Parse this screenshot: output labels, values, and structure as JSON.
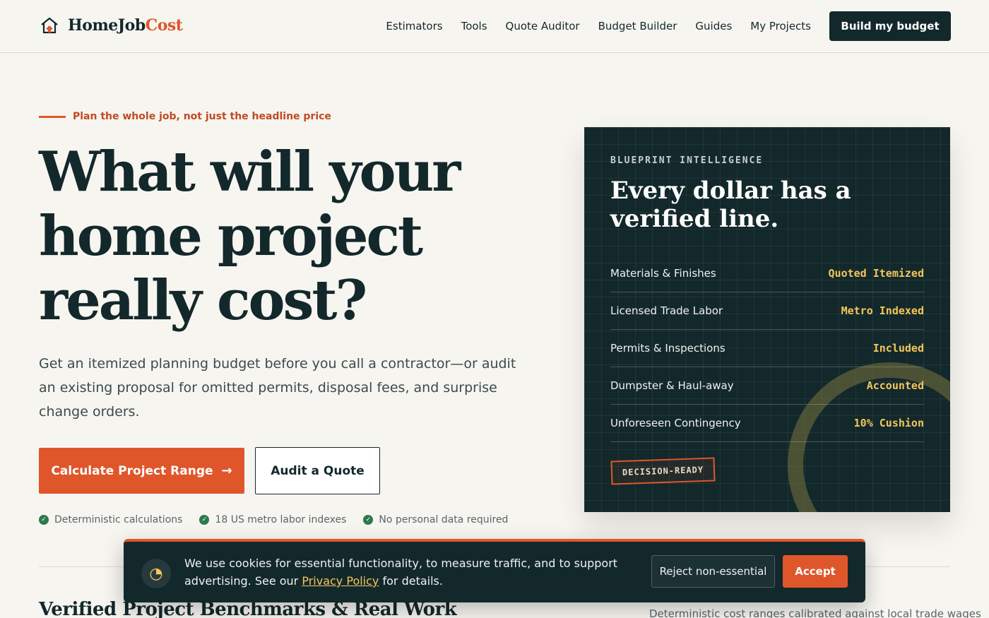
{
  "header": {
    "logo_part1": "HomeJob",
    "logo_part2": "Cost",
    "nav": [
      "Estimators",
      "Tools",
      "Quote Auditor",
      "Budget Builder",
      "Guides",
      "My Projects"
    ],
    "cta": "Build my budget"
  },
  "hero": {
    "eyebrow": "Plan the whole job, not just the headline price",
    "title_line1": "What will your",
    "title_line2": "home project",
    "title_line3": "really cost?",
    "subtitle": "Get an itemized planning budget before you call a contractor—or audit an existing proposal for omitted permits, disposal fees, and surprise change orders.",
    "primary_cta": "Calculate Project Range",
    "primary_arrow": "→",
    "secondary_cta": "Audit a Quote",
    "trust": [
      "Deterministic calculations",
      "18 US metro labor indexes",
      "No personal data required"
    ]
  },
  "card": {
    "eyebrow": "BLUEPRINT INTELLIGENCE",
    "title": "Every dollar has a verified line.",
    "rows": [
      {
        "label": "Materials & Finishes",
        "value": "Quoted Itemized"
      },
      {
        "label": "Licensed Trade Labor",
        "value": "Metro Indexed"
      },
      {
        "label": "Permits & Inspections",
        "value": "Included"
      },
      {
        "label": "Dumpster & Haul-away",
        "value": "Accounted"
      },
      {
        "label": "Unforeseen Contingency",
        "value": "10% Cushion"
      }
    ],
    "stamp": "DECISION-READY"
  },
  "section": {
    "title": "Verified Project Benchmarks & Real Work",
    "subtitle": "Deterministic cost ranges calibrated against local trade wages"
  },
  "cookie": {
    "text_before": "We use cookies for essential functionality, to measure traffic, and to support advertising. See our ",
    "link": "Privacy Policy",
    "text_after": " for details.",
    "reject": "Reject non-essential",
    "accept": "Accept"
  },
  "colors": {
    "accent": "#e0562b",
    "dark": "#13282b",
    "highlight": "#f3c65a",
    "background": "#f7f5f0"
  }
}
